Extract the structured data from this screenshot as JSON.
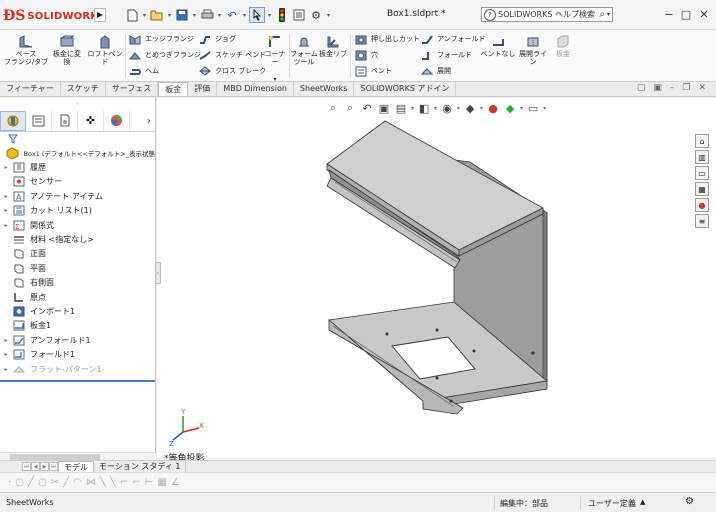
{
  "app": {
    "brand": "SOLIDWORKS",
    "document_title": "Box1.sldprt *"
  },
  "search": {
    "placeholder": "SOLIDWORKS ヘルプ検索"
  },
  "window": {
    "minimize": "−",
    "restore": "□",
    "close": "✕"
  },
  "ribbon": {
    "base_flange": "ベース\nフランジ/タブ",
    "convert_to_sheet": "板金に変\n換",
    "lofted_bend": "ロフトベンド",
    "edge_flange": "エッジフランジ",
    "miter_flange": "とめつぎフランジ",
    "hem": "ヘム",
    "jog": "ジョグ",
    "sketched_bend": "スケッチ ベンド",
    "cross_break": "クロス ブレーク",
    "corners": "コーナー",
    "forming_tool": "フォーム\nツール",
    "sheet_gusset": "板金リブ",
    "extruded_cut": "押し出しカット",
    "hole": "穴",
    "vent": "ベント",
    "unfold": "アンフォールド",
    "fold": "フォールド",
    "flatten": "展開",
    "no_bends": "ベントなし",
    "rip": "展開ライン",
    "sheet_metal_grey": "板金"
  },
  "tabs": [
    "フィーチャー",
    "スケッチ",
    "サーフェス",
    "板金",
    "評価",
    "MBD Dimension",
    "SheetWorks",
    "SOLIDWORKS アドイン"
  ],
  "active_tab": "板金",
  "tree": {
    "root": "Box1 (デフォルト<<デフォルト>_表示状態",
    "items": [
      {
        "label": "履歴",
        "icon": "history-icon",
        "expandable": true
      },
      {
        "label": "センサー",
        "icon": "sensor-icon",
        "expandable": false
      },
      {
        "label": "アノテート アイテム",
        "icon": "annotation-icon",
        "expandable": true
      },
      {
        "label": "カット リスト(1)",
        "icon": "cut-list-icon",
        "expandable": true
      },
      {
        "label": "関係式",
        "icon": "equation-icon",
        "expandable": true
      },
      {
        "label": "材料 <指定なし>",
        "icon": "material-icon",
        "expandable": false
      },
      {
        "label": "正面",
        "icon": "plane-icon",
        "expandable": false
      },
      {
        "label": "平面",
        "icon": "plane-icon",
        "expandable": false
      },
      {
        "label": "右側面",
        "icon": "plane-icon",
        "expandable": false
      },
      {
        "label": "原点",
        "icon": "origin-icon",
        "expandable": false
      },
      {
        "label": "インポート1",
        "icon": "import-icon",
        "expandable": false
      },
      {
        "label": "板金1",
        "icon": "sheet-metal-icon",
        "expandable": false
      },
      {
        "label": "アンフォールド1",
        "icon": "unfold-icon",
        "expandable": true
      },
      {
        "label": "フォールド1",
        "icon": "fold-icon",
        "expandable": true
      },
      {
        "label": "フラット-パターン1",
        "icon": "flat-pattern-icon",
        "expandable": true,
        "grey": true
      }
    ]
  },
  "view": {
    "orientation_label": "*等角投影"
  },
  "bottom_tabs": [
    "モデル",
    "モーション スタディ 1"
  ],
  "status": {
    "product": "SheetWorks",
    "edit_state": "編集中：部品",
    "units": "ユーザー定義",
    "caret": "▲"
  },
  "colors": {
    "brand_red": "#d52b1e",
    "accent_blue": "#3c7ac4"
  }
}
